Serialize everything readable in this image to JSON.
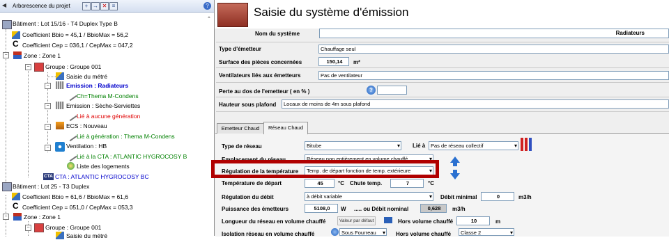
{
  "tree": {
    "header": {
      "title": "Arborescence du projet"
    },
    "nodes": [
      "Bâtiment : Lot 15/16 - T4 Duplex Type B",
      "Coefficient Bbio = 45,1 / BbioMax = 56,2",
      "Coefficient Cep =  036,1 / CepMax =  047,2",
      "Zone : Zone 1",
      "Groupe : Groupe 001",
      "Saisie du métré",
      "Emission : Radiateurs",
      "Ch=Thema M-Condens",
      "Emission : Sèche-Serviettes",
      "Lié à aucune génération",
      "ECS : Nouveau",
      "Lié à génération : Thema M-Condens",
      "Ventilation : HB",
      "Lié à la CTA : ATLANTIC HYGROCOSY B",
      "Liste des logements",
      "CTA : ATLANTIC HYGROCOSY BC",
      "Bâtiment : Lot 25 - T3 Duplex",
      "Coefficient Bbio = 61,6 / BbioMax = 61,6",
      "Coefficient Cep =  051,0 / CepMax =  053,3",
      "Zone : Zone 1",
      "Groupe : Groupe 001",
      "Saisie du métré"
    ],
    "cta_badge": "CTA"
  },
  "form": {
    "title": "Saisie du système d'émission",
    "nom_label": "Nom du système",
    "nom_value": "Radiateurs",
    "type_label": "Type d'émetteur",
    "type_value": "Chauffage seul",
    "surface_label": "Surface des pièces concernées",
    "surface_value": "150,14",
    "surface_unit": "m²",
    "vent_label": "Ventilateurs liés aux émetteurs",
    "vent_value": "Pas de ventilateur",
    "perte_label": "Perte au dos de l'emetteur ( en % )",
    "hauteur_label": "Hauteur sous plafond",
    "hauteur_value": "Locaux de moins de 4m sous plafond",
    "tabs": [
      "Emetteur Chaud",
      "Réseau Chaud"
    ],
    "reseau": {
      "type_label": "Type de réseau",
      "type_value": "Bitube",
      "lie_label": "Lié à",
      "lie_value": "Pas de réseau collectif",
      "emplacement_label": "Emplacement du réseau",
      "emplacement_value": "Réseau non entièrement en volume chauffé",
      "regulation_label": "Régulation de la température",
      "regulation_value": "Temp. de départ fonction de temp. extérieure",
      "temp_label": "Température de départ",
      "temp_value": "45",
      "temp_unit": "°C",
      "chute_label": "Chute temp.",
      "chute_value": "7",
      "chute_unit": "°C",
      "debit_label": "Régulation du débit",
      "debit_value": "à débit variable",
      "debit_min_label": "Débit minimal",
      "debit_min_value": "0",
      "debit_min_unit": "m3/h",
      "puissance_label": "Puissance des émetteurs",
      "puissance_value": "5108,0",
      "puissance_unit": "W",
      "debit_nom_label": "..... ou Débit nominal",
      "debit_nom_value": "0,628",
      "debit_nom_unit": "m3/h",
      "longueur_label": "Longueur du réseau en volume chauffé",
      "valeur_defaut": "Valeur par défaut",
      "hors_label": "Hors volume chauffé",
      "hors_value": "10",
      "hors_unit": "m",
      "isolation_label": "Isolation réseau en volume chauffé",
      "isolation_value": "Sous Fourreau",
      "hors2_label": "Hors volume chauffé",
      "hors2_value": "Classe 2"
    }
  },
  "colors": {
    "highlight": "#b00000",
    "accent_blue": "#0000cc",
    "red_text": "#e00000",
    "green_text": "#008000"
  }
}
